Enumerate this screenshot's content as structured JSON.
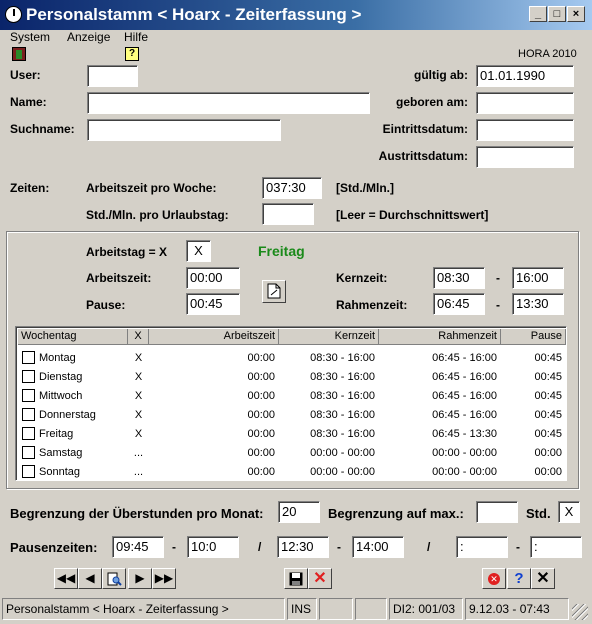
{
  "window": {
    "title": "Personalstamm < Hoarx - Zeiterfassung  >"
  },
  "menu": [
    "System",
    "Anzeige",
    "Hilfe"
  ],
  "brand": "HORA  2010",
  "header": {
    "user_label": "User:",
    "user_value": "",
    "name_label": "Name:",
    "name_value": "",
    "suchname_label": "Suchname:",
    "suchname_value": "",
    "gueltig_label": "gültig ab:",
    "gueltig_value": "01.01.1990",
    "geboren_label": "geboren am:",
    "geboren_value": "",
    "eintritt_label": "Eintrittsdatum:",
    "eintritt_value": "",
    "austritt_label": "Austrittsdatum:",
    "austritt_value": ""
  },
  "zeiten": {
    "label": "Zeiten:",
    "woche_label": "Arbeitszeit pro Woche:",
    "woche_value": "037:30",
    "woche_unit": "[Std./Mln.]",
    "urlaub_label": "Std./Mln. pro Urlaubstag:",
    "urlaub_value": "",
    "urlaub_hint": "[Leer = Durchschnittswert]"
  },
  "day": {
    "arbeitstag_label": "Arbeitstag = X",
    "arbeitstag_value": "X",
    "dayname": "Freitag",
    "arbeitszeit_label": "Arbeitszeit:",
    "arbeitszeit_value": "00:00",
    "pause_label": "Pause:",
    "pause_value": "00:45",
    "kernzeit_label": "Kernzeit:",
    "kernzeit_from": "08:30",
    "kernzeit_sep": "-",
    "kernzeit_to": "16:00",
    "rahmenzeit_label": "Rahmenzeit:",
    "rahmenzeit_from": "06:45",
    "rahmenzeit_sep": "-",
    "rahmenzeit_to": "13:30"
  },
  "table": {
    "headers": [
      "Wochentag",
      "X",
      "Arbeitszeit",
      "Kernzeit",
      "Rahmenzeit",
      "Pause"
    ],
    "rows": [
      {
        "day": "Montag",
        "x": "X",
        "arbeitszeit": "00:00",
        "kernzeit": "08:30 - 16:00",
        "rahmenzeit": "06:45 - 16:00",
        "pause": "00:45"
      },
      {
        "day": "Dienstag",
        "x": "X",
        "arbeitszeit": "00:00",
        "kernzeit": "08:30 - 16:00",
        "rahmenzeit": "06:45 - 16:00",
        "pause": "00:45"
      },
      {
        "day": "Mittwoch",
        "x": "X",
        "arbeitszeit": "00:00",
        "kernzeit": "08:30 - 16:00",
        "rahmenzeit": "06:45 - 16:00",
        "pause": "00:45"
      },
      {
        "day": "Donnerstag",
        "x": "X",
        "arbeitszeit": "00:00",
        "kernzeit": "08:30 - 16:00",
        "rahmenzeit": "06:45 - 16:00",
        "pause": "00:45"
      },
      {
        "day": "Freitag",
        "x": "X",
        "arbeitszeit": "00:00",
        "kernzeit": "08:30 - 16:00",
        "rahmenzeit": "06:45 - 13:30",
        "pause": "00:45"
      },
      {
        "day": "Samstag",
        "x": "...",
        "arbeitszeit": "00:00",
        "kernzeit": "00:00 - 00:00",
        "rahmenzeit": "00:00 - 00:00",
        "pause": "00:00"
      },
      {
        "day": "Sonntag",
        "x": "...",
        "arbeitszeit": "00:00",
        "kernzeit": "00:00 - 00:00",
        "rahmenzeit": "00:00 - 00:00",
        "pause": "00:00"
      }
    ]
  },
  "ueberstunden": {
    "label": "Begrenzung der Überstunden pro Monat:",
    "value": "20",
    "max_label": "Begrenzung auf max.:",
    "max_value": "",
    "std_label": "Std.",
    "std_value": "X"
  },
  "pausen": {
    "label": "Pausenzeiten:",
    "p1_from": "09:45",
    "p1_to": "10:0",
    "p2_from": "12:30",
    "p2_to": "14:00",
    "p3_from": " :",
    "p3_to": " :",
    "dash": "-",
    "slash": "/"
  },
  "statusbar": {
    "title": "Personalstamm < Hoarx - Zeiterfassung  >",
    "ins": "INS",
    "position": "DI2: 001/03",
    "datetime": "9.12.03 - 07:43"
  },
  "colors": {
    "titlebar": "#0a246a",
    "dayname": "#1a8a1a",
    "delete": "#e02020",
    "help": "#1040d0"
  }
}
